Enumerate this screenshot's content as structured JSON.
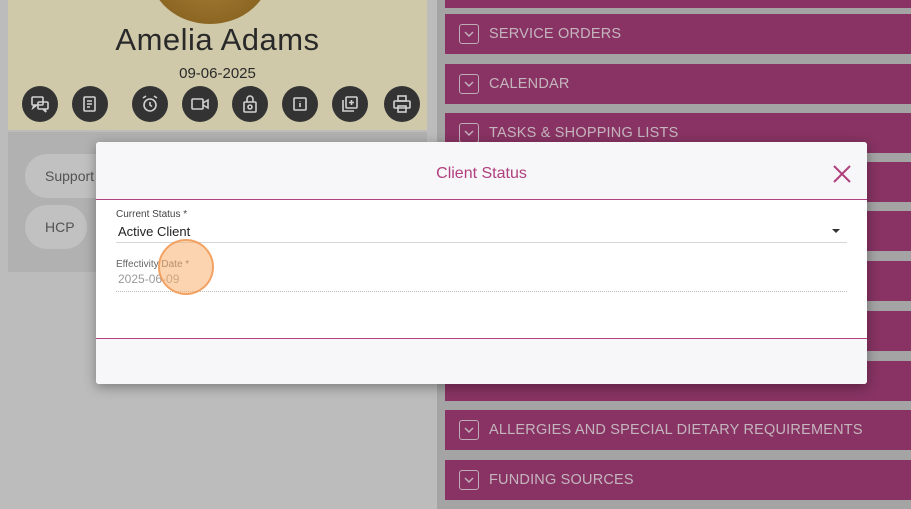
{
  "client": {
    "name": "Amelia Adams",
    "date": "09-06-2025"
  },
  "profile_actions": [
    {
      "icon": "chat-bubbles-icon"
    },
    {
      "icon": "notes-icon"
    },
    {
      "icon": "alarm-clock-icon"
    },
    {
      "icon": "video-camera-icon"
    },
    {
      "icon": "lock-refresh-icon"
    },
    {
      "icon": "info-icon"
    },
    {
      "icon": "add-copy-icon"
    },
    {
      "icon": "printer-icon"
    }
  ],
  "tags": [
    {
      "label": "Support"
    },
    {
      "label": "HCP"
    }
  ],
  "sections": [
    {
      "label": "SERVICE ORDERS"
    },
    {
      "label": "CALENDAR"
    },
    {
      "label": "TASKS & SHOPPING LISTS"
    },
    {
      "label": "ALLERGIES AND SPECIAL DIETARY REQUIREMENTS"
    },
    {
      "label": "FUNDING SOURCES"
    }
  ],
  "modal": {
    "title": "Client Status",
    "current_status": {
      "label": "Current Status *",
      "value": "Active Client"
    },
    "effectivity_date": {
      "label": "Effectivity Date *",
      "placeholder": "2025-06-09"
    }
  },
  "colors": {
    "accent": "#b0407e",
    "section_bar": "#a73f79",
    "profile_bg": "#fdf6cf"
  }
}
